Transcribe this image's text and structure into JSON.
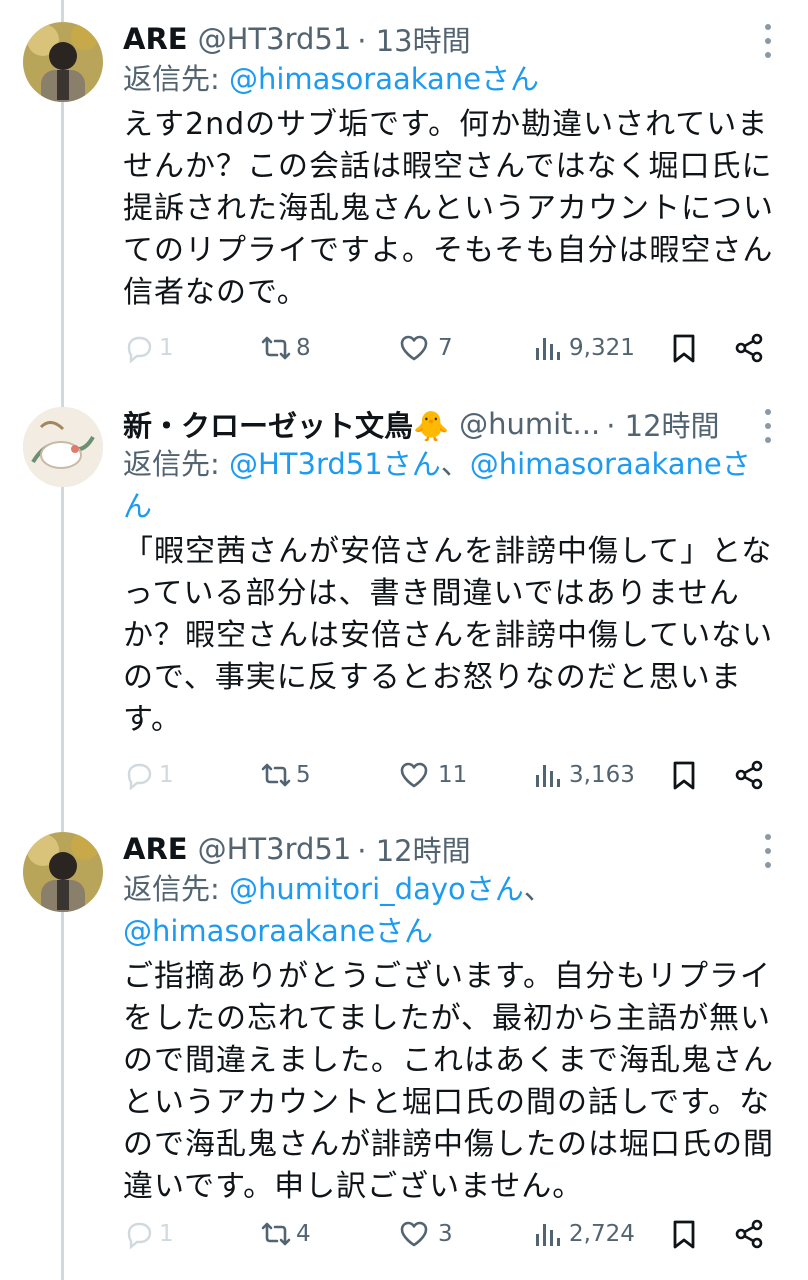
{
  "tweets": [
    {
      "name": "ARE",
      "handle": "@HT3rd51",
      "time": "· 13時間",
      "replying_prefix": "返信先: ",
      "mentions": [
        "@himasoraakaneさん"
      ],
      "mention_separator": "",
      "body": "えす2ndのサブ垢です。何か勘違いされていませんか？この会話は暇空さんではなく堀口氏に提訴された海乱鬼さんというアカウントについてのリプライですよ。そもそも自分は暇空さん信者なので。",
      "replies": "1",
      "retweets": "8",
      "likes": "7",
      "views": "9,321",
      "avatar_icon": "avatar-photo-icon"
    },
    {
      "name": "新・クローゼット文鳥🐥",
      "handle": "@humit...",
      "time": "· 12時間",
      "replying_prefix": "返信先: ",
      "mentions": [
        "@HT3rd51さん",
        "@himasoraakaneさん"
      ],
      "mention_separator": "、",
      "body": "「暇空茜さんが安倍さんを誹謗中傷して」となっている部分は、書き間違いではありませんか？暇空さんは安倍さんを誹謗中傷していないので、事実に反するとお怒りなのだと思います。",
      "replies": "1",
      "retweets": "5",
      "likes": "11",
      "views": "3,163",
      "avatar_icon": "avatar-illustration-icon"
    },
    {
      "name": "ARE",
      "handle": "@HT3rd51",
      "time": "· 12時間",
      "replying_prefix": "返信先: ",
      "mentions": [
        "@humitori_dayoさん",
        "@himasoraakaneさん"
      ],
      "mention_separator": "、",
      "body": "ご指摘ありがとうございます。自分もリプライをしたの忘れてましたが、最初から主語が無いので間違えました。これはあくまで海乱鬼さんというアカウントと堀口氏の間の話しです。なので海乱鬼さんが誹謗中傷したのは堀口氏の間違いです。申し訳ございません。",
      "replies": "1",
      "retweets": "4",
      "likes": "3",
      "views": "2,724",
      "avatar_icon": "avatar-photo-icon"
    }
  ],
  "colors": {
    "accent": "#1d9bf0",
    "secondary_text": "#536471",
    "thread_line": "#cfd9de"
  }
}
